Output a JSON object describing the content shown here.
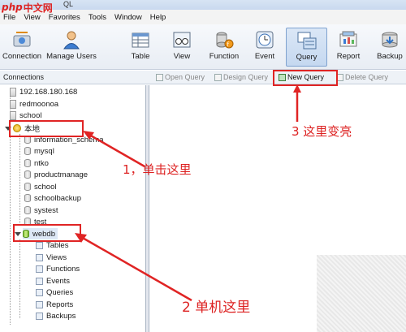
{
  "window": {
    "title": "QL"
  },
  "watermark": {
    "php": "php",
    "cn": "中文网"
  },
  "menu": [
    "File",
    "View",
    "Favorites",
    "Tools",
    "Window",
    "Help"
  ],
  "toolbar": {
    "connection": "Connection",
    "manage_users": "Manage Users",
    "table": "Table",
    "view": "View",
    "function": "Function",
    "event": "Event",
    "query": "Query",
    "report": "Report",
    "backup": "Backup"
  },
  "subbar": {
    "connections": "Connections",
    "open_query": "Open Query",
    "design_query": "Design Query",
    "new_query": "New Query",
    "delete_query": "Delete Query"
  },
  "tree": {
    "servers": [
      "192.168.180.168",
      "redmoonoa",
      "school"
    ],
    "local": "本地",
    "local_dbs": [
      "information_schema",
      "mysql",
      "ntko",
      "productmanage",
      "school",
      "schoolbackup",
      "systest",
      "test"
    ],
    "webdb": "webdb",
    "webdb_children": [
      "Tables",
      "Views",
      "Functions",
      "Events",
      "Queries",
      "Reports",
      "Backups"
    ]
  },
  "annotations": {
    "step1": "1，单击这里",
    "step2": "2 单机这里",
    "step3": "3 这里变亮"
  },
  "colors": {
    "annotation_red": "#e02424",
    "accent_blue": "#7fa2cf"
  }
}
